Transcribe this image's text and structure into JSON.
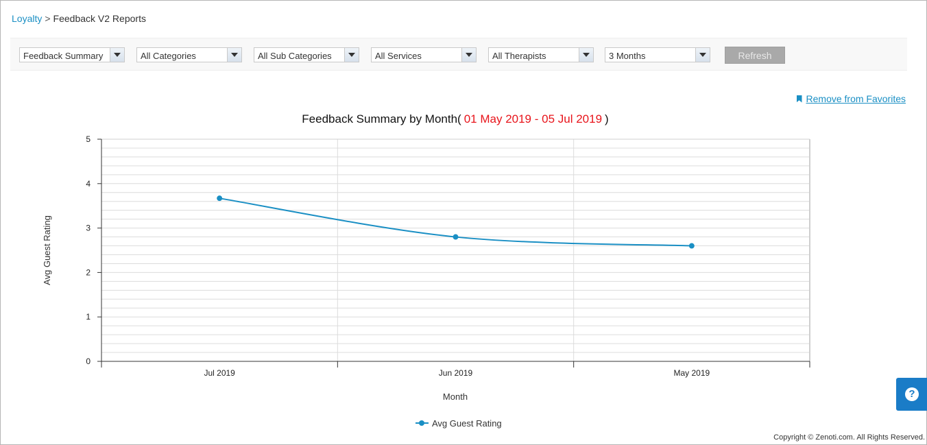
{
  "breadcrumb": {
    "root": "Loyalty",
    "separator": ">",
    "current": "Feedback V2 Reports"
  },
  "filters": {
    "report": "Feedback Summary",
    "category": "All Categories",
    "sub_category": "All Sub Categories",
    "service": "All Services",
    "therapist": "All Therapists",
    "period": "3 Months",
    "refresh_label": "Refresh"
  },
  "favorites": {
    "label": "Remove from Favorites",
    "icon": "bookmark-icon"
  },
  "help": {
    "icon": "question-circle-icon",
    "glyph": "?"
  },
  "copyright": "Copyright © Zenoti.com. All Rights Reserved.",
  "colors": {
    "accent": "#1a8fc4",
    "series": "#1a8fc4",
    "date_range": "#e8141b",
    "refresh_bg": "#a9a9a9"
  },
  "chart_data": {
    "type": "line",
    "title": "Feedback Summary by Month(",
    "title_range": "01 May 2019 - 05 Jul 2019",
    "title_close": ")",
    "categories": [
      "Jul 2019",
      "Jun 2019",
      "May 2019"
    ],
    "series": [
      {
        "name": "Avg Guest Rating",
        "values": [
          3.67,
          2.8,
          2.6
        ]
      }
    ],
    "xlabel": "Month",
    "ylabel": "Avg Guest Rating",
    "ylim": [
      0,
      5
    ],
    "yticks": [
      0,
      1,
      2,
      3,
      4,
      5
    ],
    "grid": true,
    "legend": "bottom-center"
  }
}
